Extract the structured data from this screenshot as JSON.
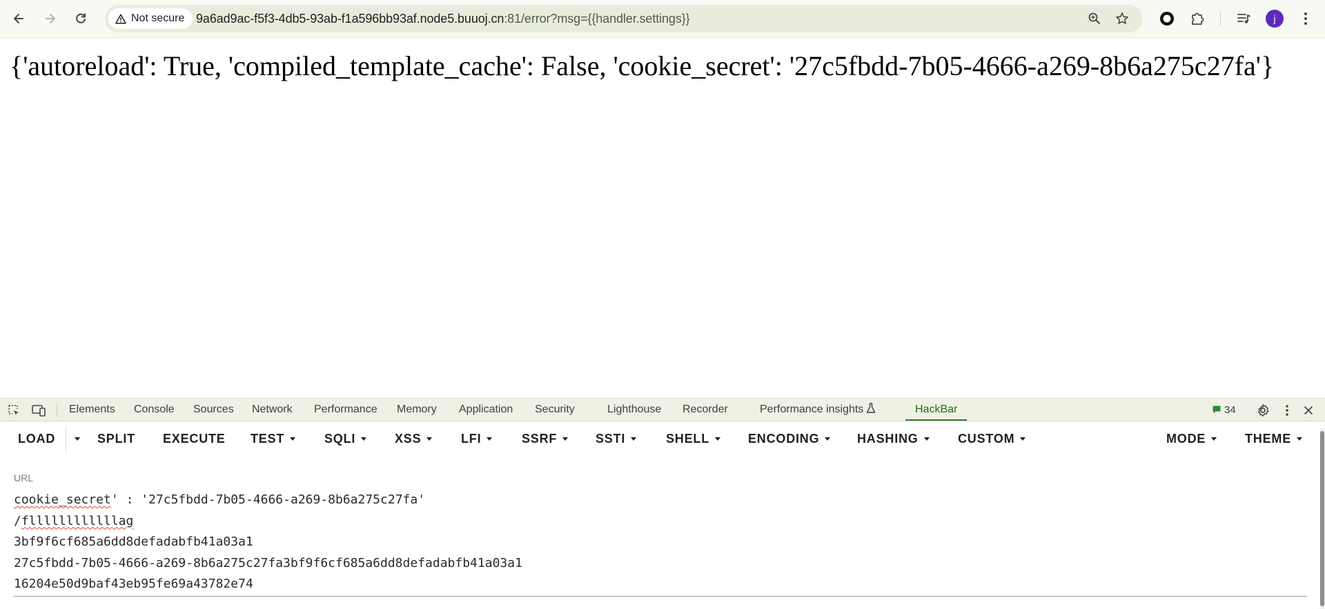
{
  "browser": {
    "security_label": "Not secure",
    "url_host": "9a6ad9ac-f5f3-4db5-93ab-f1a596bb93af.node5.buuoj.cn",
    "url_path": ":81/error?msg={{handler.settings}}",
    "avatar_letter": "j",
    "accent_color": "#5b2bb8",
    "icons": [
      "back-icon",
      "forward-icon",
      "reload-icon",
      "warning-icon",
      "zoom-icon",
      "star-icon",
      "extension-circle-icon",
      "puzzle-icon",
      "media-icon",
      "avatar",
      "more-icon"
    ]
  },
  "page": {
    "message": "{'autoreload': True, 'compiled_template_cache': False, 'cookie_secret': '27c5fbdd-7b05-4666-a269-8b6a275c27fa'}"
  },
  "devtools": {
    "tabs": [
      "Elements",
      "Console",
      "Sources",
      "Network",
      "Performance",
      "Memory",
      "Application",
      "Security",
      "Lighthouse",
      "Recorder",
      "Performance insights",
      "HackBar"
    ],
    "active_tab": "HackBar",
    "message_count": "34"
  },
  "hackbar": {
    "buttons": [
      "LOAD",
      "SPLIT",
      "EXECUTE",
      "TEST",
      "SQLI",
      "XSS",
      "LFI",
      "SSRF",
      "SSTI",
      "SHELL",
      "ENCODING",
      "HASHING",
      "CUSTOM",
      "MODE",
      "THEME"
    ],
    "url_label": "URL",
    "url_lines": [
      "cookie_secret': '27c5fbdd-7b05-4666-a269-8b6a275c27fa'",
      "/fllllllllllllag",
      "3bf9f6cf685a6dd8defadabfb41a03a1",
      "27c5fbdd-7b05-4666-a269-8b6a275c27fa3bf9f6cf685a6dd8defadabfb41a03a1",
      "16204e50d9baf43eb95fe69a43782e74"
    ]
  }
}
